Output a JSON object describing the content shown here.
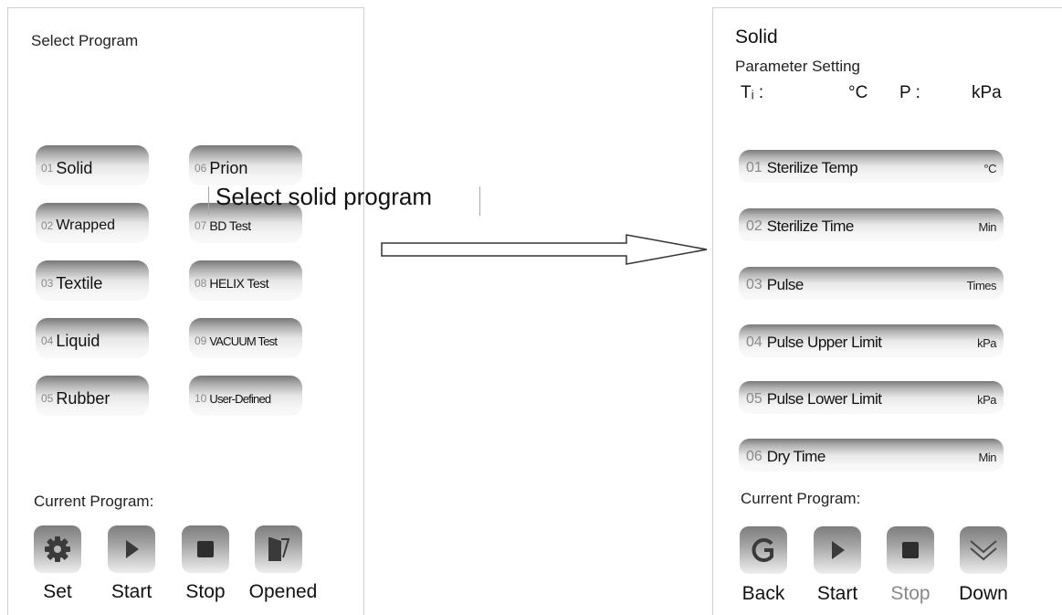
{
  "left_panel": {
    "title": "Select Program",
    "programs": [
      {
        "num": "01",
        "label": "Solid"
      },
      {
        "num": "02",
        "label": "Wrapped"
      },
      {
        "num": "03",
        "label": "Textile"
      },
      {
        "num": "04",
        "label": "Liquid"
      },
      {
        "num": "05",
        "label": "Rubber"
      },
      {
        "num": "06",
        "label": "Prion"
      },
      {
        "num": "07",
        "label": "BD Test"
      },
      {
        "num": "08",
        "label": "HELIX Test"
      },
      {
        "num": "09",
        "label": "VACUUM Test"
      },
      {
        "num": "10",
        "label": "User-Defined"
      }
    ],
    "current_program_label": "Current Program:",
    "actions": [
      {
        "icon": "gear-icon",
        "label": "Set"
      },
      {
        "icon": "play-icon",
        "label": "Start"
      },
      {
        "icon": "stop-icon",
        "label": "Stop"
      },
      {
        "icon": "door-icon",
        "label": "Opened"
      }
    ]
  },
  "annotation": {
    "text": "Select solid program"
  },
  "right_panel": {
    "title": "Solid",
    "subtitle": "Parameter Setting",
    "ti_label": "Tᵢ :",
    "temp_unit": "°C",
    "p_label": "P :",
    "pressure_unit": "kPa",
    "parameters": [
      {
        "num": "01",
        "label": "Sterilize Temp",
        "unit": "°C"
      },
      {
        "num": "02",
        "label": "Sterilize  Time",
        "unit": "Min"
      },
      {
        "num": "03",
        "label": "Pulse",
        "unit": "Times"
      },
      {
        "num": "04",
        "label": "Pulse Upper Limit",
        "unit": "kPa"
      },
      {
        "num": "05",
        "label": "Pulse Lower Limit",
        "unit": "kPa"
      },
      {
        "num": "06",
        "label": "Dry Time",
        "unit": "Min"
      }
    ],
    "current_program_label": "Current Program:",
    "actions": [
      {
        "icon": "back-icon",
        "label": "Back"
      },
      {
        "icon": "play-icon",
        "label": "Start"
      },
      {
        "icon": "stop-icon",
        "label": "Stop"
      },
      {
        "icon": "chevron-down-icon",
        "label": "Down"
      }
    ]
  },
  "colors": {
    "panel_border": "#cfcfcf",
    "button_dark": "#777777",
    "button_light": "#f9f9f9",
    "icon_fill": "#3a3a3a",
    "muted_text": "#888888"
  }
}
